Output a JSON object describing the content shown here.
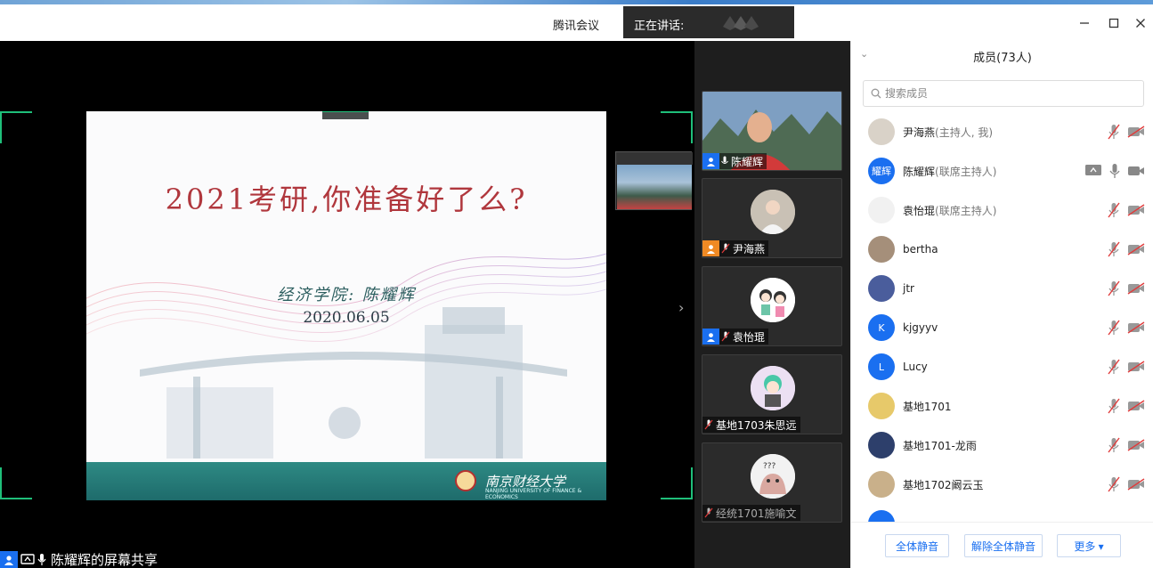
{
  "titlebar": {
    "app_title": "腾讯会议",
    "speaking_label": "正在讲话:"
  },
  "slide": {
    "title": "2021考研,你准备好了么?",
    "author": "经济学院: 陈耀辉",
    "date": "2020.06.05",
    "university": "南京财经大学",
    "university_en": "NANJING UNIVERSITY OF FINANCE & ECONOMICS"
  },
  "share_bar": {
    "label": "陈耀辉的屏幕共享"
  },
  "tiles": [
    {
      "name": "陈耀辉",
      "badge": "blue"
    },
    {
      "name": "尹海燕",
      "badge": "orange"
    },
    {
      "name": "袁怡琨",
      "badge": "blue"
    },
    {
      "name": "基地1703朱思远",
      "badge": ""
    },
    {
      "name": "经统1701施喻文",
      "badge": ""
    }
  ],
  "panel": {
    "title": "成员(73人)",
    "search_placeholder": "搜索成员",
    "members": [
      {
        "name": "尹海燕",
        "role": "(主持人, 我)",
        "avatar_text": "",
        "avatar_color": "#d9d2c8",
        "share": false,
        "mic_on": false,
        "cam_on": false
      },
      {
        "name": "陈耀辉",
        "role": "(联席主持人)",
        "avatar_text": "耀辉",
        "avatar_color": "#1a6ff0",
        "share": true,
        "mic_on": true,
        "cam_on": true
      },
      {
        "name": "袁怡琨",
        "role": "(联席主持人)",
        "avatar_text": "",
        "avatar_color": "#f1f1f1",
        "share": false,
        "mic_on": false,
        "cam_on": false
      },
      {
        "name": "bertha",
        "role": "",
        "avatar_text": "",
        "avatar_color": "#a58f7a",
        "share": false,
        "mic_on": false,
        "cam_on": false
      },
      {
        "name": "jtr",
        "role": "",
        "avatar_text": "",
        "avatar_color": "#4a5d9c",
        "share": false,
        "mic_on": false,
        "cam_on": false
      },
      {
        "name": "kjgyyv",
        "role": "",
        "avatar_text": "K",
        "avatar_color": "#1a6ff0",
        "share": false,
        "mic_on": false,
        "cam_on": false
      },
      {
        "name": "Lucy",
        "role": "",
        "avatar_text": "L",
        "avatar_color": "#1a6ff0",
        "share": false,
        "mic_on": false,
        "cam_on": false
      },
      {
        "name": "基地1701",
        "role": "",
        "avatar_text": "",
        "avatar_color": "#e7c96a",
        "share": false,
        "mic_on": false,
        "cam_on": false
      },
      {
        "name": "基地1701-龙雨",
        "role": "",
        "avatar_text": "",
        "avatar_color": "#2d3f6b",
        "share": false,
        "mic_on": false,
        "cam_on": false
      },
      {
        "name": "基地1702阚云玉",
        "role": "",
        "avatar_text": "",
        "avatar_color": "#c9b08a",
        "share": false,
        "mic_on": false,
        "cam_on": false
      }
    ],
    "buttons": {
      "mute_all": "全体静音",
      "unmute_all": "解除全体静音",
      "more": "更多 ▾"
    }
  }
}
